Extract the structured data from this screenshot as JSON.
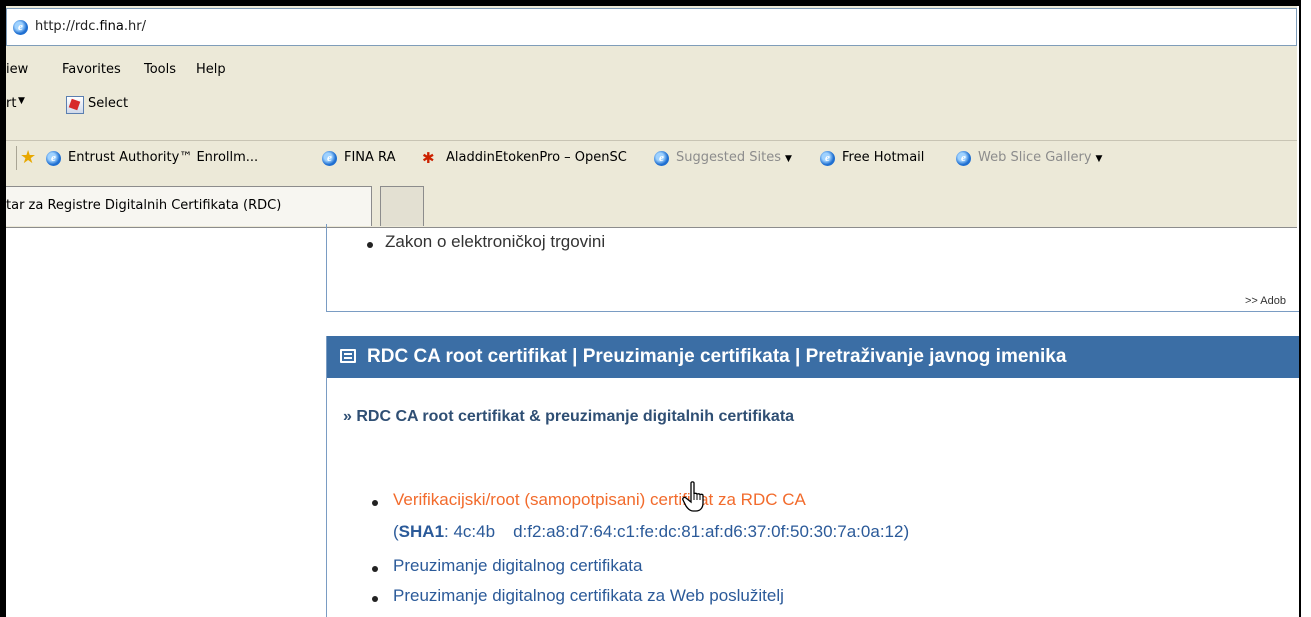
{
  "browser": {
    "address": {
      "prefix": "http://rdc.",
      "domain": "fina",
      "suffix": ".hr/"
    },
    "menu": [
      "iew",
      "Favorites",
      "Tools",
      "Help"
    ],
    "command_bar": {
      "convert_label": "rt",
      "select_label": "Select"
    },
    "favorites": [
      {
        "label": "Entrust Authority™ Enrollm...",
        "icon": "ie-icon"
      },
      {
        "label": "FINA RA",
        "icon": "ie-icon"
      },
      {
        "label": "AladdinEtokenPro – OpenSC",
        "icon": "aladdin-icon"
      },
      {
        "label": "Suggested Sites",
        "icon": "ie-icon",
        "dropdown": true
      },
      {
        "label": "Free Hotmail",
        "icon": "ie-icon"
      },
      {
        "label": "Web Slice Gallery",
        "icon": "ie-icon",
        "dropdown": true
      }
    ],
    "tab": {
      "title": "tar za Registre Digitalnih Certifikata (RDC)"
    }
  },
  "page": {
    "law_item": "Zakon o elektroničkoj trgovini",
    "adobe_link": ">> Adob",
    "section_header": "RDC CA root certifikat | Preuzimanje certifikata | Pretraživanje javnog imenika",
    "sub_title": "» RDC CA root certifikat & preuzimanje digitalnih certifikata",
    "items": [
      "Verifikacijski/root (samopotpisani) certifikat za RDC CA",
      "Preuzimanje digitalnog certifikata",
      "Preuzimanje digitalnog certifikata za Web poslužitelj"
    ],
    "sha": {
      "label": "SHA1",
      "open": "(",
      "value": ": 4c:4b",
      "value_rest": "d:f2:a8:d7:64:c1:fe:dc:81:af:d6:37:0f:50:30:7a:0a:12)"
    }
  }
}
